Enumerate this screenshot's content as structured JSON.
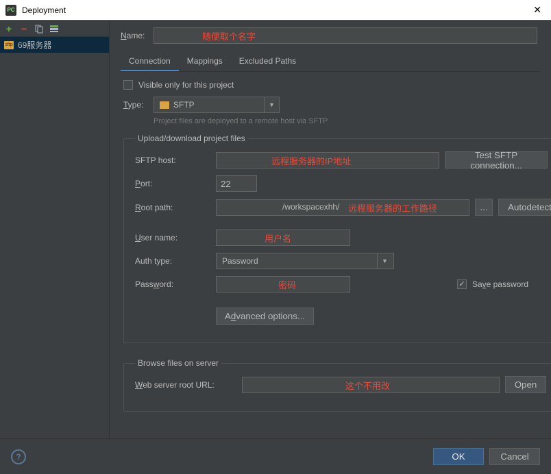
{
  "window": {
    "title": "Deployment",
    "close": "✕"
  },
  "sidebar": {
    "server_name": "69服务器"
  },
  "name": {
    "label": "Name:"
  },
  "tabs": {
    "connection": "Connection",
    "mappings": "Mappings",
    "excluded": "Excluded Paths"
  },
  "form": {
    "visible_only": "Visible only for this project",
    "type_label": "Type:",
    "type_value": "SFTP",
    "type_hint": "Project files are deployed to a remote host via SFTP",
    "upload_legend": "Upload/download project files",
    "sftp_host_label": "SFTP host:",
    "test_connection": "Test SFTP connection...",
    "port_label": "Port:",
    "port_value": "22",
    "root_label": "Root path:",
    "root_visible": "/workspacexhh/",
    "root_browse": "...",
    "autodetect": "Autodetect",
    "user_label": "User name:",
    "auth_label": "Auth type:",
    "auth_value": "Password",
    "password_label": "Password:",
    "save_password": "Save password",
    "advanced": "Advanced options...",
    "browse_legend": "Browse files on server",
    "web_url_label": "Web server root URL:",
    "open": "Open"
  },
  "annotations": {
    "name": "随便取个名字",
    "host": "远程服务器的IP地址",
    "root": "远程服务器的工作路径",
    "user": "用户名",
    "pass": "密码",
    "url": "这个不用改"
  },
  "footer": {
    "ok": "OK",
    "cancel": "Cancel"
  }
}
